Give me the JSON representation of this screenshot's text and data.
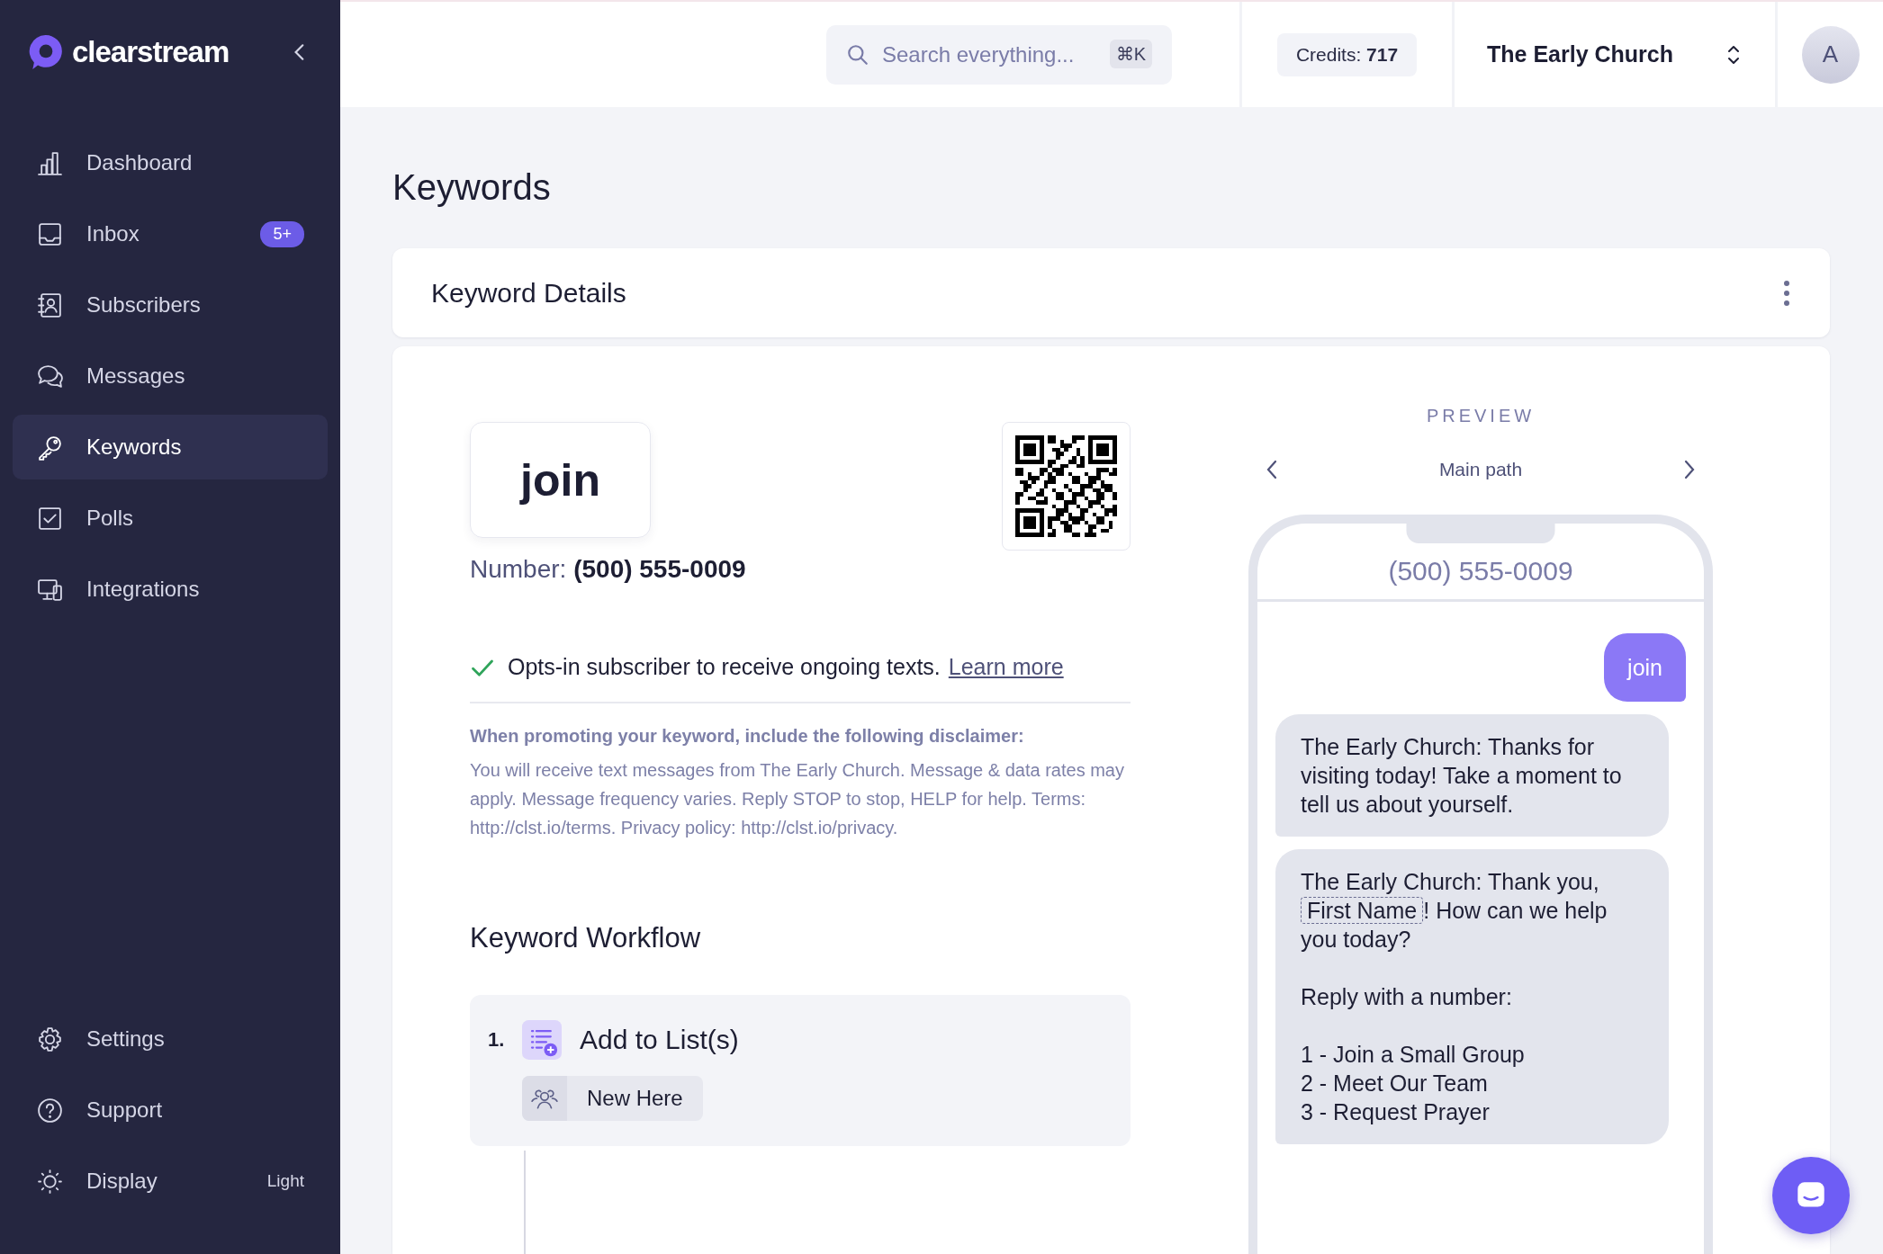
{
  "brand": {
    "name": "clearstream"
  },
  "sidebar": {
    "items": [
      {
        "label": "Dashboard",
        "selected": false
      },
      {
        "label": "Inbox",
        "selected": false,
        "badge": "5+"
      },
      {
        "label": "Subscribers",
        "selected": false
      },
      {
        "label": "Messages",
        "selected": false
      },
      {
        "label": "Keywords",
        "selected": true
      },
      {
        "label": "Polls",
        "selected": false
      },
      {
        "label": "Integrations",
        "selected": false
      }
    ],
    "footer_items": [
      {
        "label": "Settings"
      },
      {
        "label": "Support"
      },
      {
        "label": "Display",
        "value": "Light"
      }
    ]
  },
  "topbar": {
    "search": {
      "placeholder": "Search everything...",
      "shortcut": "⌘K"
    },
    "credits_label": "Credits:",
    "credits_value": "717",
    "organization": "The Early Church",
    "avatar": "A"
  },
  "page": {
    "title": "Keywords"
  },
  "details": {
    "title": "Keyword Details"
  },
  "keyword": {
    "word": "join",
    "number_label": "Number:",
    "number": "(500) 555-0009",
    "opt_in": {
      "text": "Opts-in subscriber to receive ongoing texts.",
      "link": "Learn more"
    },
    "disclaimer_title": "When promoting your keyword, include the following disclaimer:",
    "disclaimer": "You will receive text messages from The Early Church. Message & data rates may apply. Message frequency varies. Reply STOP to stop, HELP for help. Terms: http://clst.io/terms. Privacy policy: http://clst.io/privacy."
  },
  "workflow": {
    "title": "Keyword Workflow",
    "steps": [
      {
        "number": "1.",
        "title": "Add to List(s)",
        "lists": [
          "New Here"
        ]
      }
    ]
  },
  "preview": {
    "heading": "PREVIEW",
    "path": "Main path",
    "phone_number": "(500) 555-0009",
    "messages": [
      {
        "kind": "outgoing",
        "paragraphs": [
          [
            {
              "kind": "text",
              "text": "join"
            }
          ]
        ]
      },
      {
        "kind": "incoming",
        "paragraphs": [
          [
            {
              "kind": "text",
              "text": "The Early Church: Thanks for visiting today! Take a moment to tell us about yourself."
            }
          ]
        ]
      },
      {
        "kind": "incoming",
        "paragraphs": [
          [
            {
              "kind": "text",
              "text": "The Early Church: Thank you,"
            },
            {
              "kind": "merge_field",
              "text": "First Name"
            },
            {
              "kind": "text",
              "text": "! How can we help"
            },
            {
              "kind": "text",
              "text": "you today?"
            }
          ],
          [
            {
              "kind": "text",
              "text": "Reply with a number:"
            }
          ],
          [
            {
              "kind": "text",
              "text": "1 - Join a Small Group"
            }
          ],
          [
            {
              "kind": "text",
              "text": "2 - Meet Our Team"
            }
          ],
          [
            {
              "kind": "text",
              "text": "3 - Request Prayer"
            }
          ]
        ]
      }
    ]
  }
}
